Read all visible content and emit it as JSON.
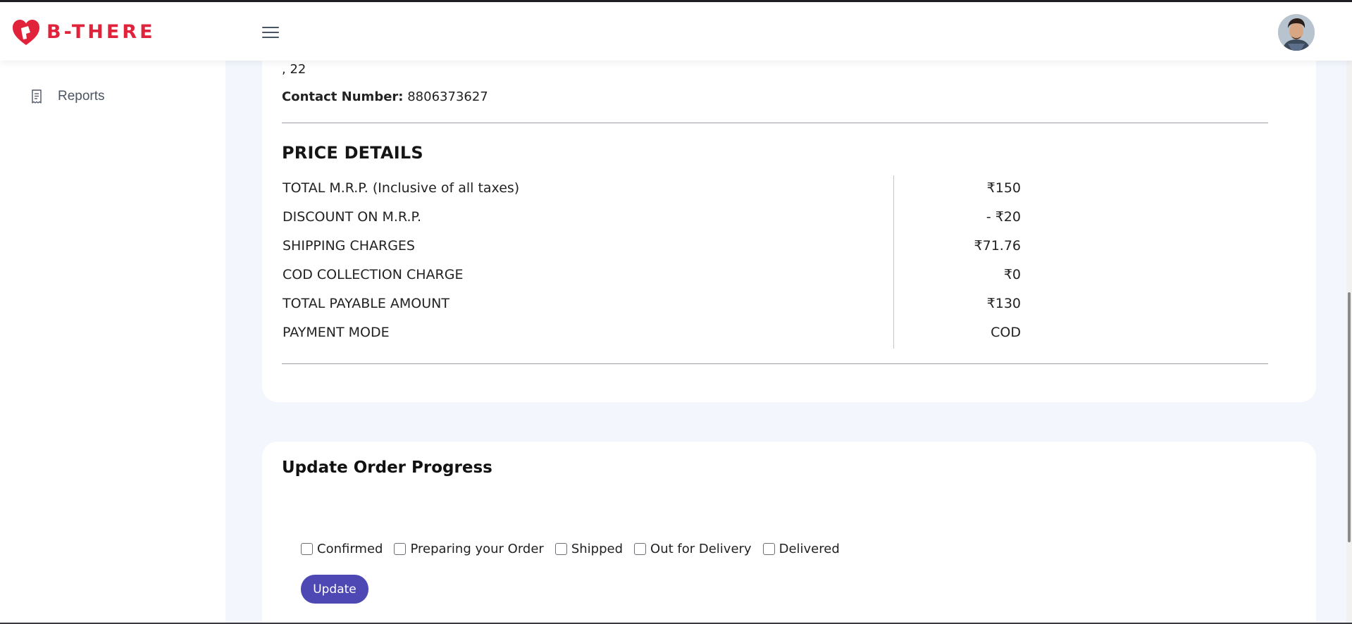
{
  "brand": {
    "name": "B-THERE",
    "color": "#e0233a",
    "logo_icon": "heart-logo-icon"
  },
  "header": {
    "menu_icon": "hamburger-menu-icon",
    "avatar_icon": "user-avatar"
  },
  "sidebar": {
    "items": [
      {
        "label": "Reports",
        "icon": "receipt-icon"
      }
    ]
  },
  "order": {
    "address_tail": ", 22",
    "contact_label": "Contact Number:",
    "contact_value": "8806373627"
  },
  "price_details": {
    "title": "PRICE DETAILS",
    "rows": [
      {
        "label": "TOTAL M.R.P. (Inclusive of all taxes)",
        "value": "₹150"
      },
      {
        "label": "DISCOUNT ON M.R.P.",
        "value": "- ₹20"
      },
      {
        "label": "SHIPPING CHARGES",
        "value": "₹71.76"
      },
      {
        "label": "COD COLLECTION CHARGE",
        "value": "₹0"
      },
      {
        "label": "TOTAL PAYABLE AMOUNT",
        "value": "₹130"
      },
      {
        "label": "PAYMENT MODE",
        "value": "COD"
      }
    ]
  },
  "progress": {
    "title": "Update Order Progress",
    "statuses": [
      {
        "label": "Confirmed",
        "checked": false
      },
      {
        "label": "Preparing your Order",
        "checked": false
      },
      {
        "label": "Shipped",
        "checked": false
      },
      {
        "label": "Out for Delivery",
        "checked": false
      },
      {
        "label": "Delivered",
        "checked": false
      }
    ],
    "update_label": "Update",
    "button_color": "#4e48b5"
  }
}
